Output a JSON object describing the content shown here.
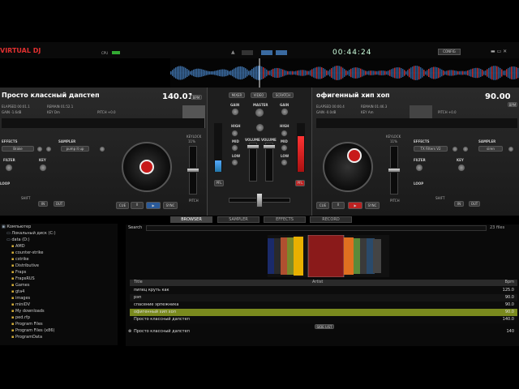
{
  "app": {
    "logo": "VIRTUAL DJ",
    "cpu_label": "CPU",
    "clock": "00:44:24",
    "config": "CONFIG"
  },
  "left_deck": {
    "title": "Просто классный дапстеп",
    "bpm": "140.01",
    "bpm_btn": "BPM",
    "elapsed": "ELAPSED 00:01.1",
    "remain": "REMAIN 01:52.1",
    "gain": "GAIN -1.6dB",
    "key": "KEY Dm",
    "pitch": "PITCH +0.0",
    "effects": "EFFECTS",
    "effect_value": "Brake",
    "sampler": "SAMPLER",
    "sampler_value": "pump it up",
    "filter": "FILTER",
    "key_lbl": "KEY",
    "loop": "LOOP",
    "cue": "CUE",
    "play": "▶",
    "sync": "SYNC",
    "in": "IN",
    "out": "OUT",
    "shift": "SHIFT",
    "keylock": "KEYLOCK",
    "pitch_lbl": "PITCH",
    "pitch_pct": "11%",
    "loop_values": [
      "1",
      "2",
      "4",
      "8",
      "16",
      "32"
    ]
  },
  "right_deck": {
    "title": "офигенный хип хоп",
    "bpm": "90.00",
    "bpm_btn": "BPM",
    "elapsed": "ELAPSED 00:00.4",
    "remain": "REMAIN 01:46.3",
    "gain": "GAIN -0.0dB",
    "key": "KEY Am",
    "pitch": "PITCH +0.0",
    "effects": "EFFECTS",
    "effect_value": "TX Filters V2",
    "sampler": "SAMPLER",
    "sampler_value": "siren",
    "filter": "FILTER",
    "key_lbl": "KEY",
    "loop": "LOOP",
    "cue": "CUE",
    "play": "▶",
    "sync": "SYNC",
    "in": "IN",
    "out": "OUT",
    "shift": "SHIFT",
    "keylock": "KEYLOCK",
    "pitch_lbl": "PITCH",
    "pitch_pct": "11%",
    "loop_values": [
      "1",
      "2",
      "4",
      "8",
      "16",
      "32"
    ]
  },
  "mixer": {
    "tabs": [
      "MIXER",
      "VIDEO",
      "SCRATCH"
    ],
    "gain": "GAIN",
    "master": "MASTER",
    "high": "HIGH",
    "mid": "MID",
    "low": "LOW",
    "volume": "VOLUME",
    "pfl": "PFL"
  },
  "browser": {
    "tabs": [
      "BROWSER",
      "SAMPLER",
      "EFFECTS",
      "RECORD"
    ],
    "search_label": "Search",
    "files_count": "23 files",
    "columns": {
      "title": "Title",
      "artist": "Artist",
      "bpm": "Bpm"
    },
    "tracks": [
      {
        "title": "пипец круть как",
        "bpm": "125.0"
      },
      {
        "title": "рэп",
        "bpm": "90.0"
      },
      {
        "title": "спасение эрпежника",
        "bpm": "90.0"
      },
      {
        "title": "офигенный хип хоп",
        "bpm": "90.0"
      },
      {
        "title": "Просто классный дапстеп",
        "bpm": "140.0"
      }
    ],
    "sidelist_label": "SIDE LIST",
    "sidelist_track": "Просто классный дапстеп",
    "sidelist_bpm": "140"
  },
  "tree": [
    "Компьютер",
    "Локальный диск (C:)",
    "data (D:)",
    "AMD",
    "counter-strike",
    "cstrike",
    "Distributive",
    "Fraps",
    "FrapsRUS",
    "Games",
    "gta4",
    "images",
    "miniDV",
    "My downloads",
    "ped.rfp",
    "Program Files",
    "Program Files (x86)",
    "ProgramData"
  ],
  "colors": {
    "accent": "#c81a1a",
    "selected_row": "#7a8a1e"
  }
}
